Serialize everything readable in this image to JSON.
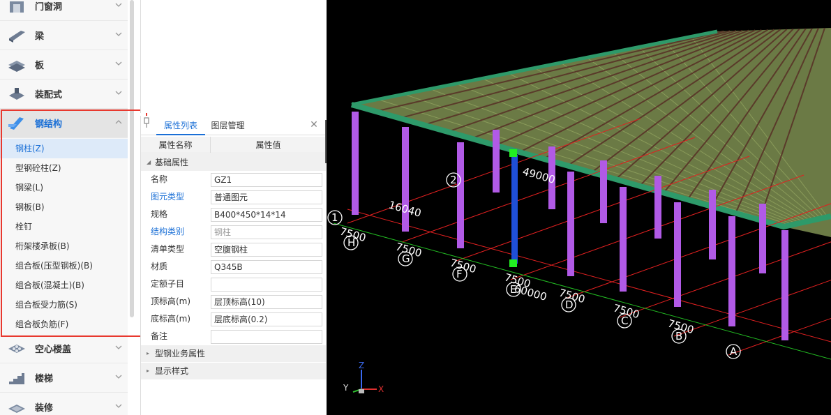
{
  "sidebar": {
    "categories_top": [
      {
        "label": "门窗洞",
        "icon": "door-window-icon"
      },
      {
        "label": "梁",
        "icon": "beam-icon"
      },
      {
        "label": "板",
        "icon": "slab-icon"
      },
      {
        "label": "装配式",
        "icon": "prefab-icon"
      }
    ],
    "active_category": {
      "label": "钢结构",
      "icon": "steel-structure-icon"
    },
    "sub_items": [
      "钢柱(Z)",
      "型钢砼柱(Z)",
      "钢梁(L)",
      "钢板(B)",
      "栓钉",
      "桁架楼承板(B)",
      "组合板(压型钢板)(B)",
      "组合板(混凝土)(B)",
      "组合板受力筋(S)",
      "组合板负筋(F)"
    ],
    "selected_sub_index": 0,
    "categories_bottom": [
      {
        "label": "空心楼盖",
        "icon": "hollow-floor-icon"
      },
      {
        "label": "楼梯",
        "icon": "stair-icon"
      },
      {
        "label": "装修",
        "icon": "decoration-icon"
      }
    ]
  },
  "properties": {
    "tabs": [
      "属性列表",
      "图层管理"
    ],
    "columns": [
      "属性名称",
      "属性值"
    ],
    "group_basic": "基础属性",
    "rows": [
      {
        "name": "名称",
        "value": "GZ1",
        "blue": false,
        "gray": false
      },
      {
        "name": "图元类型",
        "value": "普通图元",
        "blue": true,
        "gray": false
      },
      {
        "name": "规格",
        "value": "B400*450*14*14",
        "blue": false,
        "gray": false
      },
      {
        "name": "结构类别",
        "value": "钢柱",
        "blue": true,
        "gray": true
      },
      {
        "name": "清单类型",
        "value": "空腹钢柱",
        "blue": false,
        "gray": false
      },
      {
        "name": "材质",
        "value": "Q345B",
        "blue": false,
        "gray": false
      },
      {
        "name": "定额子目",
        "value": "",
        "blue": false,
        "gray": false
      },
      {
        "name": "顶标高(m)",
        "value": "层顶标高(10)",
        "blue": false,
        "gray": false
      },
      {
        "name": "底标高(m)",
        "value": "层底标高(0.2)",
        "blue": false,
        "gray": false
      },
      {
        "name": "备注",
        "value": "",
        "blue": false,
        "gray": false
      }
    ],
    "group_steel": "型钢业务属性",
    "group_display": "显示样式"
  },
  "viewport": {
    "axis_labels": [
      "H",
      "G",
      "F",
      "E",
      "D",
      "C",
      "B",
      "A"
    ],
    "side_labels": [
      "1",
      "2"
    ],
    "dimensions": [
      "7500",
      "7500",
      "7500",
      "7500",
      "7500",
      "7500",
      "7500",
      "16040",
      "60000",
      "49000"
    ],
    "triad": {
      "x": "X",
      "y": "Y",
      "z": "Z"
    },
    "colors": {
      "column": "#b15ae6",
      "selected_column": "#1f4fd8",
      "beam": "#2e9a6a",
      "slab": "#6b7a45",
      "grid": "#e02020"
    }
  }
}
